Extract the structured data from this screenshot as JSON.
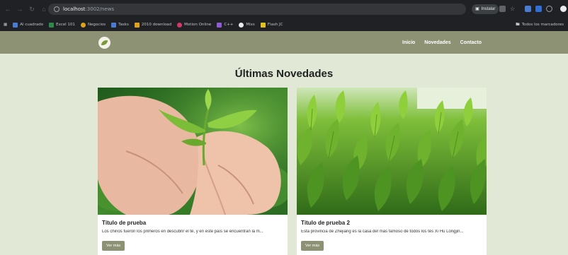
{
  "browser": {
    "url_host": "localhost",
    "url_path": ":3002/news",
    "install_label": "Instalar",
    "bookmarks": [
      {
        "label": "Al cuadrado",
        "color": "#4a7bd0"
      },
      {
        "label": "Excel 101",
        "color": "#2f8a4a"
      },
      {
        "label": "Negocios",
        "color": "#e0a21b"
      },
      {
        "label": "Tasks",
        "color": "#4a7bd0"
      },
      {
        "label": "2010 download",
        "color": "#e0a21b"
      },
      {
        "label": "Motion Online",
        "color": "#d23a6a"
      },
      {
        "label": "C++",
        "color": "#8e5ad6"
      },
      {
        "label": "Mixs",
        "color": "#e8eaed"
      },
      {
        "label": "Flash JC",
        "color": "#e0c21b"
      }
    ],
    "bookmarks_right": "Todos los marcadores"
  },
  "nav": {
    "links": [
      "Inicio",
      "Novedades",
      "Contacto"
    ]
  },
  "main": {
    "title": "Últimas Novedades",
    "cards": [
      {
        "title": "Título de prueba",
        "text": "Los chinos fueron los primeros en descubrir el té, y en este país se encuentran la m...",
        "button": "Ver más"
      },
      {
        "title": "Título de prueba 2",
        "text": "Esta provincia de Zhejiang es la casa del más famoso de todos los tés Xi Hu Longjin...",
        "button": "Ver más"
      }
    ]
  }
}
